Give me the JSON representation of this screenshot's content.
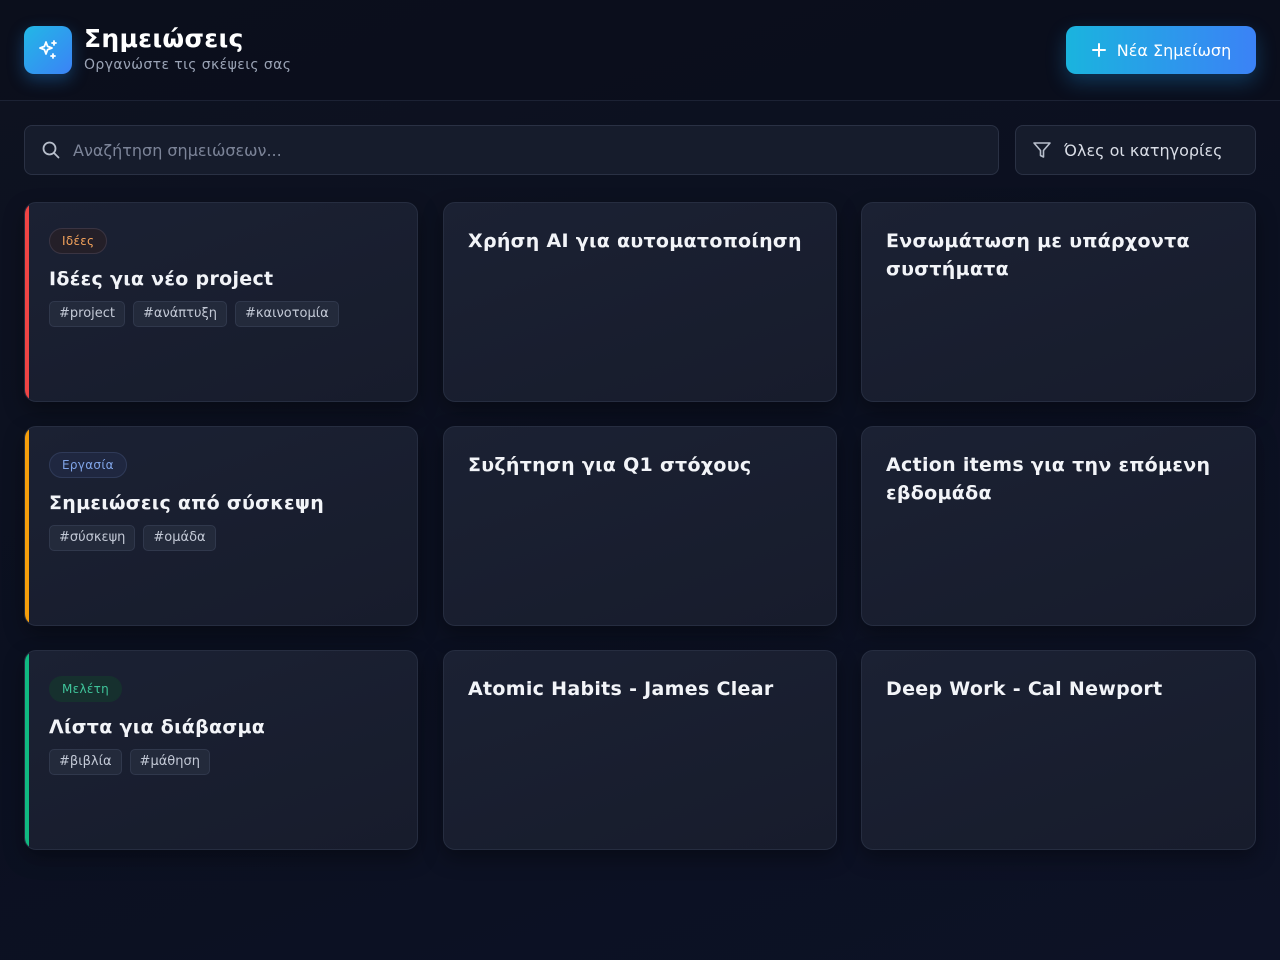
{
  "header": {
    "title": "Σημειώσεις",
    "subtitle": "Οργανώστε τις σκέψεις σας",
    "new_button_label": "Νέα Σημείωση"
  },
  "search": {
    "placeholder": "Αναζήτηση σημειώσεων...",
    "value": ""
  },
  "filter": {
    "label": "Όλες οι κατηγορίες"
  },
  "colors": {
    "accent_ideas": "#ef4444",
    "accent_work": "#f59e0b",
    "accent_study": "#10b981",
    "brand_gradient_start": "#1ab4de",
    "brand_gradient_end": "#3b82f6"
  },
  "notes": [
    {
      "category": "Ιδέες",
      "title": "Ιδέες για νέο project",
      "tags": [
        "#project",
        "#ανάπτυξη",
        "#καινοτομία"
      ]
    },
    {
      "title": "Χρήση AI για αυτοματοποίηση"
    },
    {
      "title": "Ενσωμάτωση με υπάρχοντα συστήματα"
    },
    {
      "category": "Εργασία",
      "title": "Σημειώσεις από σύσκεψη",
      "tags": [
        "#σύσκεψη",
        "#ομάδα"
      ]
    },
    {
      "title": "Συζήτηση για Q1 στόχους"
    },
    {
      "title": "Action items για την επόμενη εβδομάδα"
    },
    {
      "category": "Μελέτη",
      "title": "Λίστα για διάβασμα",
      "tags": [
        "#βιβλία",
        "#μάθηση"
      ]
    },
    {
      "title": "Atomic Habits - James Clear"
    },
    {
      "title": "Deep Work - Cal Newport"
    }
  ],
  "icons": {
    "logo": "sparkles-icon",
    "new_button": "plus-icon",
    "search": "search-icon",
    "filter": "filter-icon"
  }
}
